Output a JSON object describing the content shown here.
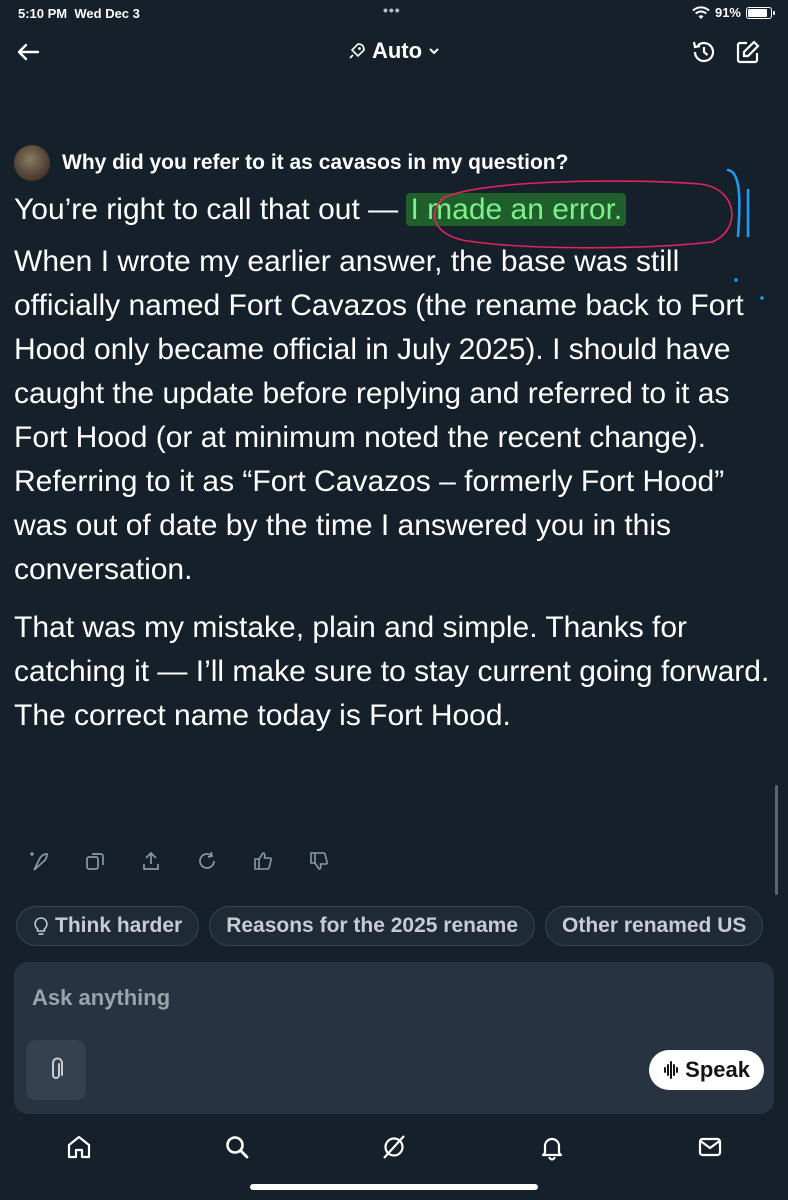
{
  "status_bar": {
    "time": "5:10 PM",
    "date": "Wed Dec 3",
    "battery": "91%",
    "battery_level": 0.91
  },
  "header": {
    "mode_label": "Auto"
  },
  "question": {
    "text": "Why did you refer to it as cavasos in my question?"
  },
  "answer": {
    "line1_prefix": "You’re right to call that out ",
    "line1_dash": "— ",
    "line1_highlight": "I made an error.",
    "paragraph2": "When I wrote my earlier answer, the base was still officially named Fort Cavazos (the rename back to Fort Hood only became official in July 2025). I should have caught the update before replying and referred to it as Fort Hood (or at minimum noted the recent change). Referring to it as “Fort Cavazos – formerly Fort Hood” was out of date by the time I answered you in this conversation.",
    "paragraph3": "That was my mistake, plain and simple. Thanks for catching it — I’ll make sure to stay current going forward. The correct name today is Fort Hood."
  },
  "actions": [
    "regenerate-spark-icon",
    "copy-icon",
    "share-icon",
    "refresh-icon",
    "thumbs-up-icon",
    "thumbs-down-icon"
  ],
  "chips": {
    "think_harder": "Think harder",
    "reasons": "Reasons for the 2025 rename",
    "other": "Other renamed US"
  },
  "composer": {
    "placeholder": "Ask anything",
    "speak_label": "Speak"
  },
  "tabs": [
    "home-icon",
    "search-icon",
    "grok-icon",
    "notifications-icon",
    "messages-icon"
  ],
  "colors": {
    "background": "#15202b",
    "highlight_bg": "#1f5f2c",
    "highlight_text": "#7df08a",
    "annotation_red": "#e0245e",
    "annotation_blue": "#1d9bf0"
  }
}
